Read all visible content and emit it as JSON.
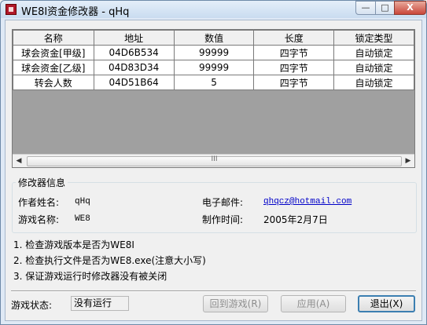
{
  "window": {
    "title": "WE8I资金修改器 - qHq"
  },
  "table": {
    "columns": [
      "名称",
      "地址",
      "数值",
      "长度",
      "锁定类型"
    ],
    "rows": [
      [
        "球会资金[甲级]",
        "04D6B534",
        "99999",
        "四字节",
        "自动锁定"
      ],
      [
        "球会资金[乙级]",
        "04D83D34",
        "99999",
        "四字节",
        "自动锁定"
      ],
      [
        "转会人数",
        "04D51B64",
        "5",
        "四字节",
        "自动锁定"
      ]
    ],
    "scroll_left": "◀",
    "scroll_right": "▶",
    "scroll_grip": "III"
  },
  "info": {
    "group_title": "修改器信息",
    "author_label": "作者姓名:",
    "author_value": "qHq",
    "email_label": "电子邮件:",
    "email_value": "qhqcz@hotmail.com",
    "game_label": "游戏名称:",
    "game_value": "WE8",
    "date_label": "制作时间:",
    "date_value": "2005年2月7日"
  },
  "notes": [
    "1. 检查游戏版本是否为WE8I",
    "2. 检查执行文件是否为WE8.exe(注意大小写)",
    "3. 保证游戏运行时修改器没有被关闭"
  ],
  "status": {
    "label": "游戏状态:",
    "value": "没有运行"
  },
  "buttons": {
    "return_game": "回到游戏(R)",
    "apply": "应用(A)",
    "exit": "退出(X)"
  },
  "titlebar_buttons": {
    "min": "—",
    "max": "□",
    "close": "X"
  }
}
